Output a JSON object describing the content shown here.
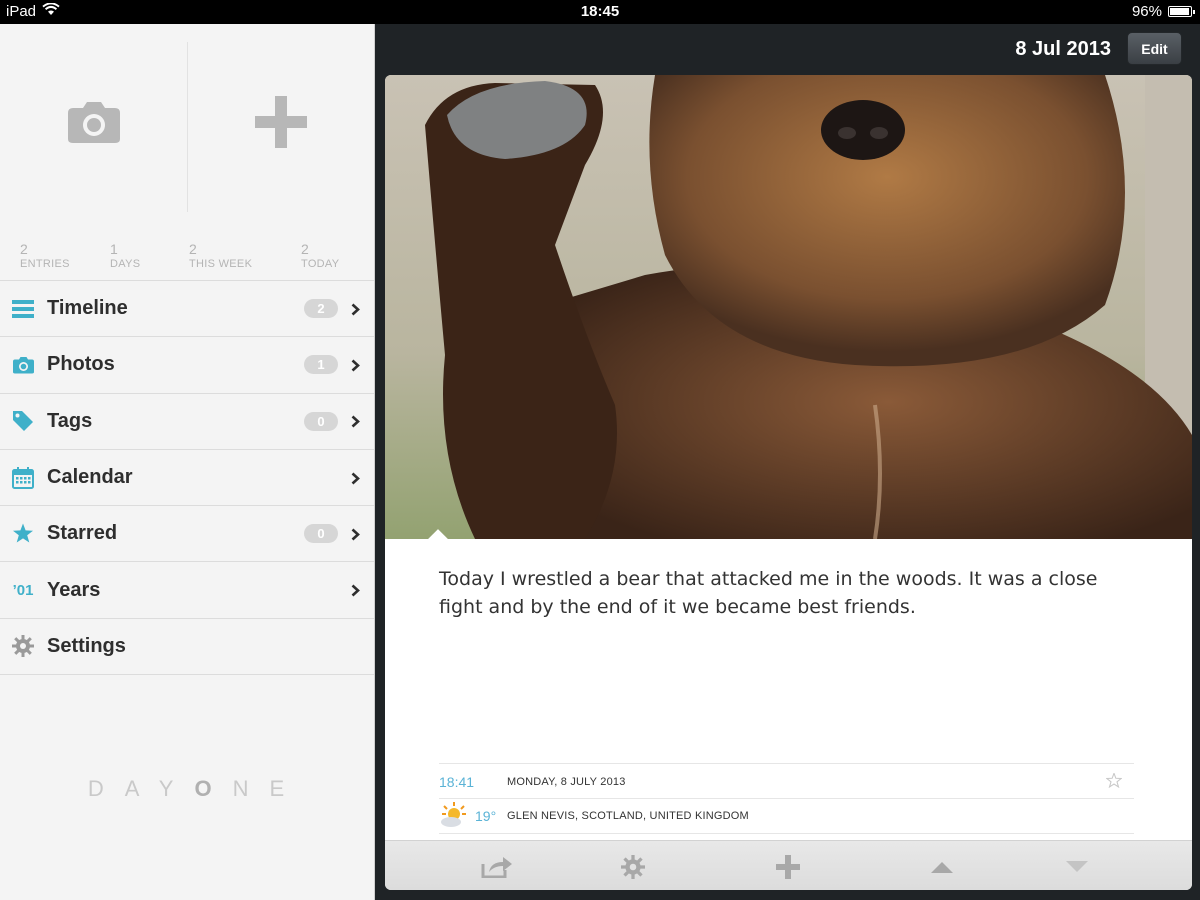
{
  "status_bar": {
    "device": "iPad",
    "time": "18:45",
    "battery": "96%",
    "battery_level": 0.96
  },
  "quick_actions": {
    "camera_icon": "camera-icon",
    "add_icon": "plus-icon"
  },
  "stats": [
    {
      "value": "2",
      "label": "ENTRIES"
    },
    {
      "value": "1",
      "label": "DAYS"
    },
    {
      "value": "2",
      "label": "THIS WEEK"
    },
    {
      "value": "2",
      "label": "TODAY"
    }
  ],
  "nav": [
    {
      "id": "timeline",
      "label": "Timeline",
      "count": "2",
      "icon": "list-icon",
      "chevron": true
    },
    {
      "id": "photos",
      "label": "Photos",
      "count": "1",
      "icon": "camera-icon",
      "chevron": true
    },
    {
      "id": "tags",
      "label": "Tags",
      "count": "0",
      "icon": "tag-icon",
      "chevron": true
    },
    {
      "id": "calendar",
      "label": "Calendar",
      "count": null,
      "icon": "calendar-icon",
      "chevron": true
    },
    {
      "id": "starred",
      "label": "Starred",
      "count": "0",
      "icon": "star-icon",
      "chevron": true
    },
    {
      "id": "years",
      "label": "Years",
      "count": null,
      "icon": "years-icon",
      "icon_text": "’01",
      "chevron": true
    },
    {
      "id": "settings",
      "label": "Settings",
      "count": null,
      "icon": "gear-icon",
      "chevron": false
    }
  ],
  "logo": {
    "letters": [
      "D",
      "A",
      "Y",
      "O",
      "N",
      "E"
    ]
  },
  "header": {
    "date": "8 Jul 2013",
    "edit_label": "Edit"
  },
  "entry": {
    "text": "Today I wrestled a bear that attacked me in the woods. It was a close fight and by the end of it we became best friends.",
    "time": "18:41",
    "date_full": "MONDAY, 8 JULY 2013",
    "temperature": "19°",
    "location": "GLEN NEVIS, SCOTLAND, UNITED KINGDOM",
    "weather_icon": "partly-sunny-icon"
  },
  "toolbar": [
    "share-icon",
    "gear-icon",
    "plus-icon",
    "up-arrow-icon",
    "down-arrow-icon"
  ],
  "colors": {
    "accent": "#3fb0c9",
    "sidebar_bg": "#f4f4f4",
    "dark_bg": "#1f2326",
    "link_blue": "#5ab3d6"
  }
}
